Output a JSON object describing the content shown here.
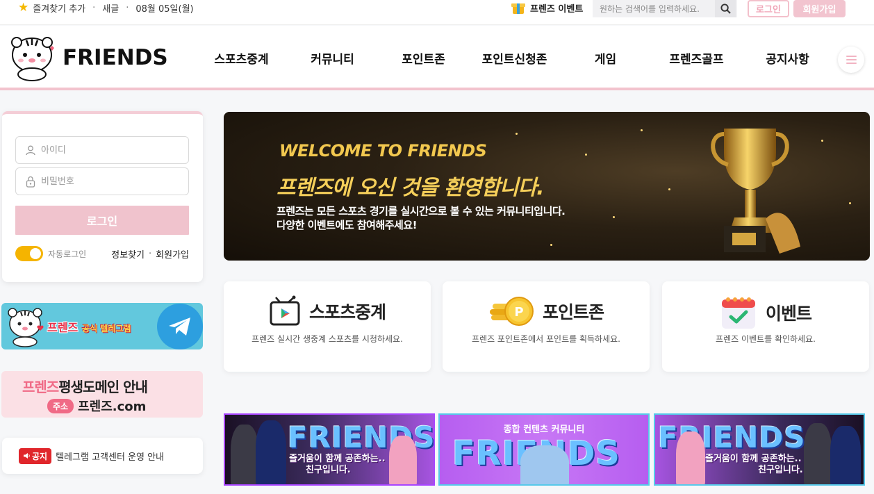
{
  "topbar": {
    "bookmark_label": "즐겨찾기 추가",
    "refresh_label": "새글",
    "date_label": "08월 05일(월)",
    "event_label": "프렌즈 이벤트",
    "search_placeholder": "원하는 검색어를 입력하세요.",
    "login_label": "로그인",
    "join_label": "회원가입"
  },
  "header": {
    "logo_text": "FRIENDS",
    "nav": [
      "스포츠중계",
      "커뮤니티",
      "포인트존",
      "포인트신청존",
      "게임",
      "프렌즈골프",
      "공지사항"
    ]
  },
  "login": {
    "id_placeholder": "아이디",
    "pw_placeholder": "비밀번호",
    "button_label": "로그인",
    "auto_login_label": "자동로그인",
    "auto_login_on": true,
    "find_label": "정보찾기",
    "join_label": "회원가입"
  },
  "side_banners": {
    "telegram_title": "프렌즈",
    "telegram_sub": "공식 텔레그램",
    "domain_brand": "프렌즈",
    "domain_title": "평생도메인 안내",
    "domain_tag": "주소",
    "domain_url": "프렌즈.com"
  },
  "notice": {
    "badge": "공지",
    "text": "텔레그램 고객센터 운영 안내"
  },
  "hero": {
    "welcome": "WELCOME TO FRIENDS",
    "title": "프렌즈에 오신 것을 환영합니다.",
    "desc1": "프렌즈는 모든 스포츠 경기를 실시간으로 볼 수 있는 커뮤니티입니다.",
    "desc2": "다양한 이벤트에도 참여해주세요!"
  },
  "cards": [
    {
      "title": "스포츠중계",
      "desc": "프렌즈 실시간 생중계 스포츠를 시청하세요.",
      "icon": "tv-icon"
    },
    {
      "title": "포인트존",
      "desc": "프렌즈 포인트존에서 포인트를 획득하세요.",
      "icon": "coin-icon"
    },
    {
      "title": "이벤트",
      "desc": "프렌즈 이벤트를 확인하세요.",
      "icon": "calendar-check-icon"
    }
  ],
  "bottom_banners": [
    {
      "logo": "FRIENDS",
      "sub1": "즐거움이 함께 공존하는..",
      "sub2": "친구입니다."
    },
    {
      "top": "종합 컨텐츠 커뮤니티",
      "logo": "FRIENDS"
    },
    {
      "logo": "FRIENDS",
      "sub1": "즐거움이 함께 공존하는..",
      "sub2": "친구입니다."
    }
  ],
  "colors": {
    "accent_pink": "#f2c3cd",
    "toggle_yellow": "#f5b400",
    "notice_red": "#e0262b",
    "hero_gold": "#f5cf5a"
  }
}
